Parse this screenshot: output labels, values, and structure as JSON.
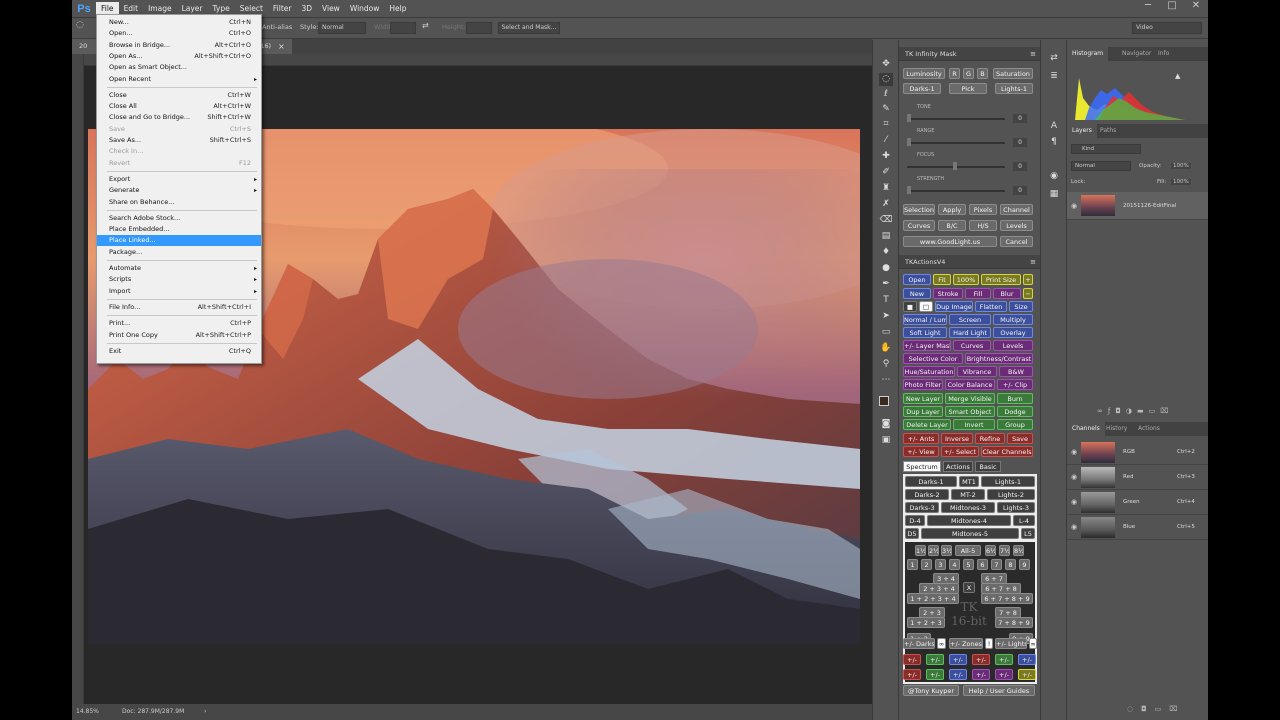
{
  "menubar": {
    "logo": "Ps",
    "items": [
      "File",
      "Edit",
      "Image",
      "Layer",
      "Type",
      "Select",
      "Filter",
      "3D",
      "View",
      "Window",
      "Help"
    ],
    "open_index": 0,
    "win_minimize": "─",
    "win_maximize": "□",
    "win_close": "✕"
  },
  "options": {
    "anti_alias": "Anti-alias",
    "style_label": "Style:",
    "style_value": "Normal",
    "width_label": "Width:",
    "height_label": "Height:",
    "select_mask": "Select and Mask...",
    "workspace": "Video"
  },
  "doc_tab": {
    "prefix": "20",
    "suffix": "/16)",
    "close": "×"
  },
  "status": {
    "zoom": "14.85%",
    "doc": "Doc: 287.9M/287.9M"
  },
  "file_menu": [
    {
      "label": "New...",
      "shortcut": "Ctrl+N"
    },
    {
      "label": "Open...",
      "shortcut": "Ctrl+O"
    },
    {
      "label": "Browse in Bridge...",
      "shortcut": "Alt+Ctrl+O"
    },
    {
      "label": "Open As...",
      "shortcut": "Alt+Shift+Ctrl+O"
    },
    {
      "label": "Open as Smart Object...",
      "shortcut": ""
    },
    {
      "label": "Open Recent",
      "shortcut": "",
      "submenu": true
    },
    {
      "sep": true
    },
    {
      "label": "Close",
      "shortcut": "Ctrl+W"
    },
    {
      "label": "Close All",
      "shortcut": "Alt+Ctrl+W"
    },
    {
      "label": "Close and Go to Bridge...",
      "shortcut": "Shift+Ctrl+W"
    },
    {
      "label": "Save",
      "shortcut": "Ctrl+S",
      "disabled": true
    },
    {
      "label": "Save As...",
      "shortcut": "Shift+Ctrl+S"
    },
    {
      "label": "Check In...",
      "shortcut": "",
      "disabled": true
    },
    {
      "label": "Revert",
      "shortcut": "F12",
      "disabled": true
    },
    {
      "sep": true
    },
    {
      "label": "Export",
      "shortcut": "",
      "submenu": true
    },
    {
      "label": "Generate",
      "shortcut": "",
      "submenu": true
    },
    {
      "label": "Share on Behance...",
      "shortcut": ""
    },
    {
      "sep": true
    },
    {
      "label": "Search Adobe Stock...",
      "shortcut": ""
    },
    {
      "label": "Place Embedded...",
      "shortcut": ""
    },
    {
      "label": "Place Linked...",
      "shortcut": "",
      "highlight": true
    },
    {
      "label": "Package...",
      "shortcut": ""
    },
    {
      "sep": true
    },
    {
      "label": "Automate",
      "shortcut": "",
      "submenu": true
    },
    {
      "label": "Scripts",
      "shortcut": "",
      "submenu": true
    },
    {
      "label": "Import",
      "shortcut": "",
      "submenu": true
    },
    {
      "sep": true
    },
    {
      "label": "File Info...",
      "shortcut": "Alt+Shift+Ctrl+I"
    },
    {
      "sep": true
    },
    {
      "label": "Print...",
      "shortcut": "Ctrl+P"
    },
    {
      "label": "Print One Copy",
      "shortcut": "Alt+Shift+Ctrl+P"
    },
    {
      "sep": true
    },
    {
      "label": "Exit",
      "shortcut": "Ctrl+Q"
    }
  ],
  "tk_infinity": {
    "title": "TK Infinity Mask",
    "row1": [
      "Luminosity",
      "R",
      "G",
      "B",
      "Saturation"
    ],
    "row2": [
      "Darks-1",
      "Pick",
      "Lights-1"
    ],
    "sliders": [
      {
        "label": "TONE",
        "value": "0"
      },
      {
        "label": "RANGE",
        "value": "0"
      },
      {
        "label": "FOCUS",
        "value": "0"
      },
      {
        "label": "STRENGTH",
        "value": "0"
      }
    ],
    "row3": [
      "Selection",
      "Apply",
      "Pixels",
      "Channel"
    ],
    "row4": [
      "Curves",
      "B/C",
      "H/S",
      "Levels"
    ],
    "website": "www.GoodLight.us",
    "cancel": "Cancel"
  },
  "tk_actions": {
    "title": "TKActionsV4",
    "rows": [
      [
        "Open",
        "Fit",
        "100%",
        "Print Size",
        "+"
      ],
      [
        "New",
        "Stroke",
        "Fill",
        "Blur",
        "−"
      ],
      [
        "■",
        "□",
        "Dup Image",
        "Flatten",
        "Size"
      ],
      [
        "Normal / Lum",
        "Screen",
        "Multiply"
      ],
      [
        "Soft Light",
        "Hard Light",
        "Overlay"
      ],
      [
        "+/- Layer Mask",
        "Curves",
        "Levels"
      ],
      [
        "Selective Color",
        "Brightness/Contrast"
      ],
      [
        "Hue/Saturation",
        "Vibrance",
        "B&W"
      ],
      [
        "Photo Filter",
        "Color Balance",
        "+/- Clip"
      ],
      [
        "New Layer",
        "Merge Visible",
        "Burn"
      ],
      [
        "Dup Layer",
        "Smart Object",
        "Dodge"
      ],
      [
        "Delete Layer",
        "Invert",
        "Group"
      ],
      [
        "+/- Ants",
        "Inverse",
        "Refine",
        "Save"
      ],
      [
        "+/- View",
        "+/- Select",
        "Clear Channels"
      ]
    ],
    "tabs": [
      "Spectrum",
      "Actions",
      "Basic"
    ],
    "spectrum": [
      [
        "Darks-1",
        "MT1",
        "Lights-1"
      ],
      [
        "Darks-2",
        "MT-2",
        "Lights-2"
      ],
      [
        "Darks-3",
        "Midtones-3",
        "Lights-3"
      ],
      [
        "D-4",
        "Midtones-4",
        "L-4"
      ],
      [
        "D5",
        "Midtones-5",
        "L5"
      ]
    ],
    "pct": [
      "1½",
      "2½",
      "3½",
      "All-5",
      "6½",
      "7½",
      "8½"
    ],
    "nums": [
      "1",
      "2",
      "3",
      "4",
      "5",
      "6",
      "7",
      "8",
      "9"
    ],
    "combos_left": [
      "3 + 4",
      "2 + 3 + 4",
      "1 + 2 + 3 + 4",
      "2 + 3",
      "1 + 2 + 3",
      "1 + 2"
    ],
    "combos_right": [
      "6 + 7",
      "6 + 7 + 8",
      "6 + 7 + 8 + 9",
      "7 + 8",
      "7 + 8 + 9",
      "8 + 9"
    ],
    "x": "X",
    "watermark": "TK 16-bit",
    "zone_row": [
      "+/- Darks",
      "∞",
      "+/- Zones",
      "!",
      "+/- Lights",
      "∞"
    ],
    "color_btn": "+/-",
    "footer": [
      "@Tony Kuyper",
      "Help / User Guides"
    ]
  },
  "histogram": {
    "tabs": [
      "Histogram",
      "Navigator",
      "Info"
    ],
    "warning": "▲"
  },
  "layers": {
    "tabs": [
      "Layers",
      "Paths"
    ],
    "kind": "Kind",
    "blend": "Normal",
    "opacity_label": "Opacity:",
    "opacity": "100%",
    "lock_label": "Lock:",
    "fill_label": "Fill:",
    "fill": "100%",
    "layer_name": "20151126-EditFinal",
    "footer_icons": [
      "link",
      "fx",
      "mask",
      "adjust",
      "folder",
      "new",
      "trash"
    ]
  },
  "channels": {
    "tabs": [
      "Channels",
      "History",
      "Actions"
    ],
    "rows": [
      {
        "name": "RGB",
        "shortcut": "Ctrl+2"
      },
      {
        "name": "Red",
        "shortcut": "Ctrl+3"
      },
      {
        "name": "Green",
        "shortcut": "Ctrl+4"
      },
      {
        "name": "Blue",
        "shortcut": "Ctrl+5"
      }
    ]
  },
  "colors": {
    "accent": "#3399ff",
    "panel": "#535353",
    "menu_bg": "#f0f0f0"
  }
}
